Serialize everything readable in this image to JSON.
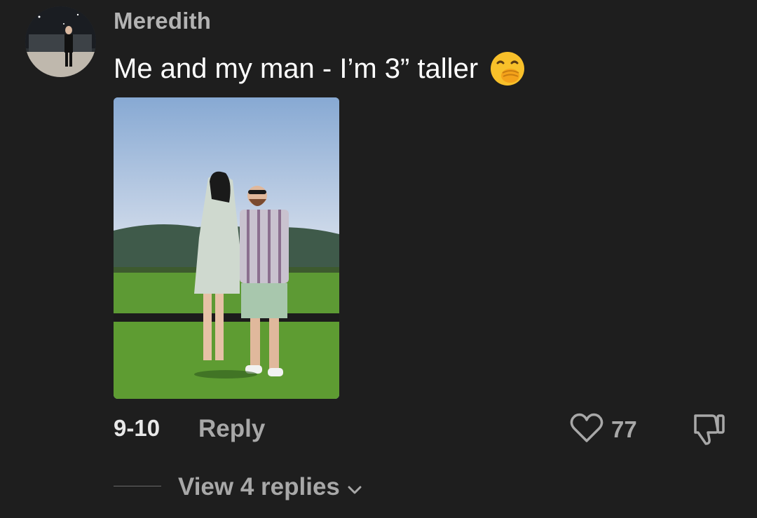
{
  "comment": {
    "username": "Meredith",
    "text": "Me and my man - I’m 3” taller",
    "emoji": "hand-over-mouth-emoji",
    "date": "9-10",
    "reply_label": "Reply",
    "like_count": "77",
    "view_replies_label": "View 4 replies"
  },
  "icons": {
    "like": "heart-icon",
    "dislike": "thumbs-down-icon",
    "expand": "chevron-down-icon"
  },
  "colors": {
    "background": "#1e1e1e",
    "username": "#b3b3b3",
    "secondary_text": "#a8a8a8"
  }
}
